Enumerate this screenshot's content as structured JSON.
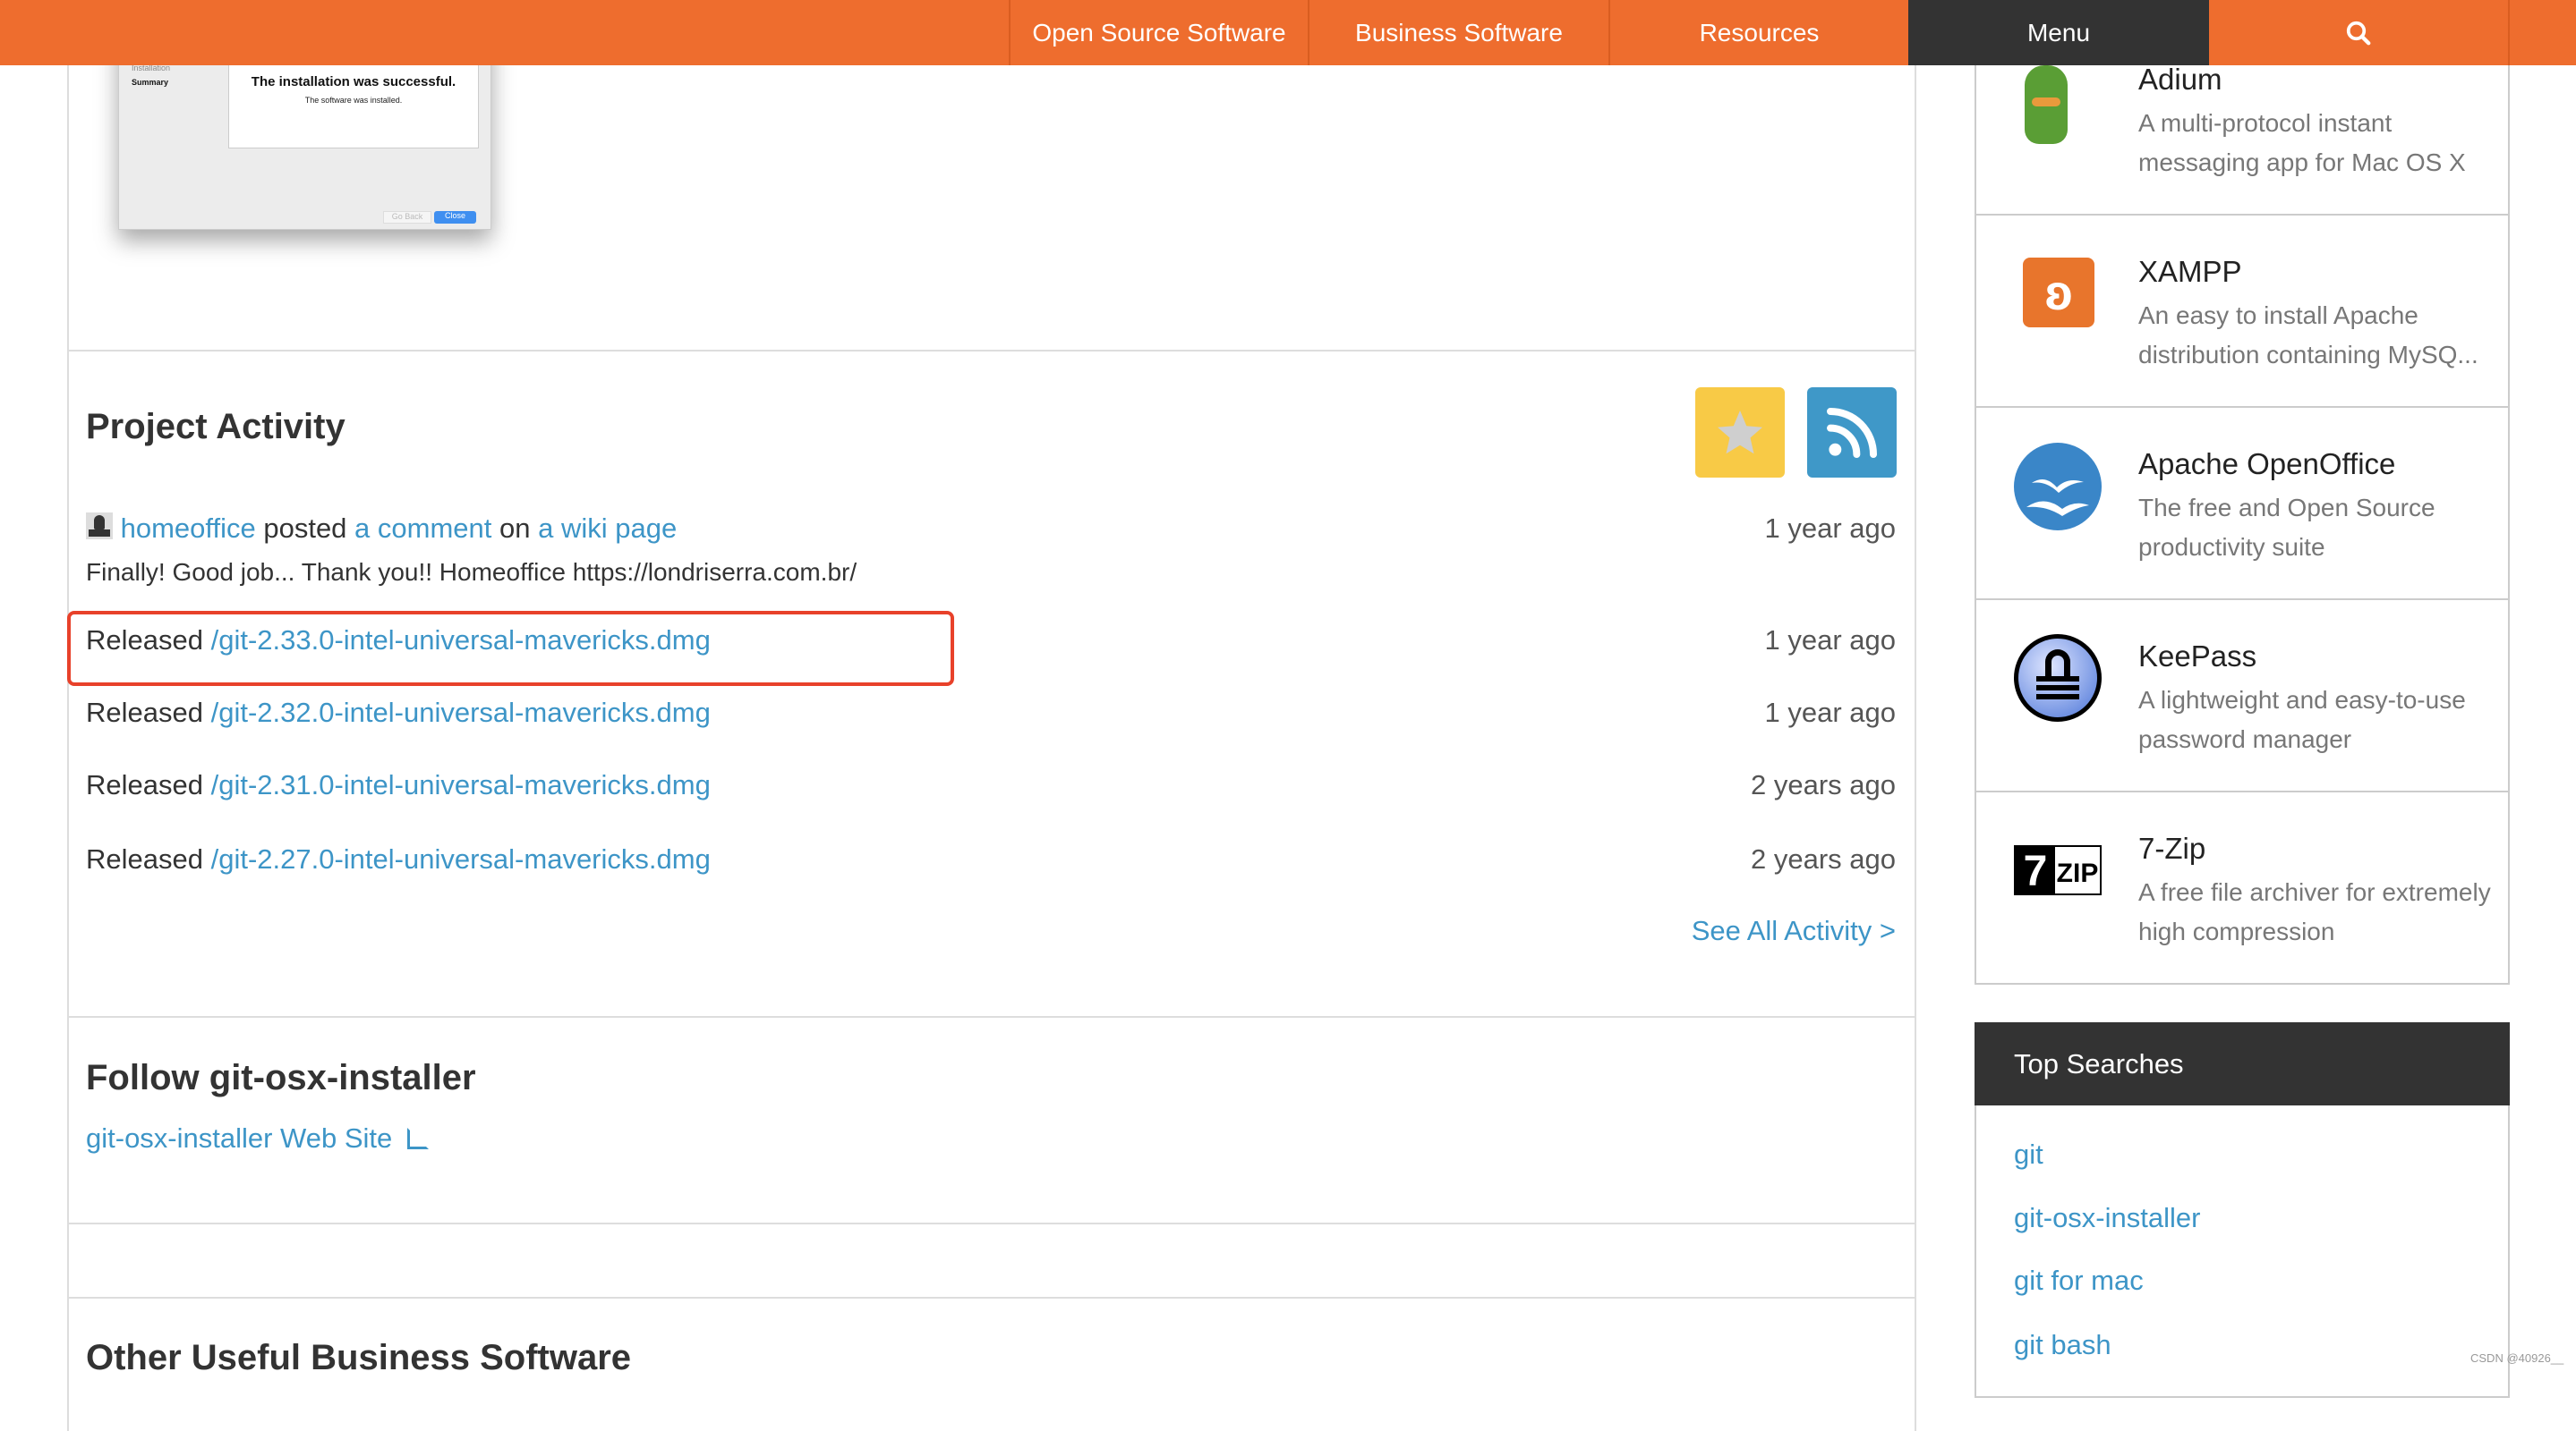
{
  "nav": {
    "items": [
      "Open Source Software",
      "Business Software",
      "Resources",
      "Menu"
    ],
    "search_icon": "search-icon",
    "color": "#ee6d2e",
    "menu_color": "#333333"
  },
  "screenshot": {
    "steps": [
      "Installation",
      "Summary"
    ],
    "heading": "The installation was successful.",
    "sub": "The software was installed.",
    "go_back": "Go Back",
    "close": "Close"
  },
  "activity": {
    "title": "Project Activity",
    "comment": {
      "user": "homeoffice",
      "posted": "posted",
      "comment_link": "a comment",
      "on": "on",
      "page_link": "a wiki page",
      "time": "1 year ago",
      "text": "Finally! Good job... Thank you!! Homeoffice https://londriserra.com.br/"
    },
    "releases": [
      {
        "label": "Released",
        "file": "/git-2.33.0-intel-universal-mavericks.dmg",
        "time": "1 year ago",
        "highlighted": true
      },
      {
        "label": "Released",
        "file": "/git-2.32.0-intel-universal-mavericks.dmg",
        "time": "1 year ago"
      },
      {
        "label": "Released",
        "file": "/git-2.31.0-intel-universal-mavericks.dmg",
        "time": "2 years ago"
      },
      {
        "label": "Released",
        "file": "/git-2.27.0-intel-universal-mavericks.dmg",
        "time": "2 years ago"
      }
    ],
    "see_all": "See All Activity >"
  },
  "follow": {
    "title": "Follow git-osx-installer",
    "link": "git-osx-installer Web Site"
  },
  "other": {
    "title": "Other Useful Business Software"
  },
  "sidebar": {
    "items": [
      {
        "name": "Adium",
        "desc": "A multi-protocol instant messaging app for Mac OS X"
      },
      {
        "name": "XAMPP",
        "desc": "An easy to install Apache distribution containing MySQ..."
      },
      {
        "name": "Apache OpenOffice",
        "desc": "The free and Open Source productivity suite"
      },
      {
        "name": "KeePass",
        "desc": "A lightweight and easy-to-use password manager"
      },
      {
        "name": "7-Zip",
        "desc": "A free file archiver for extremely high compression"
      }
    ]
  },
  "top_searches": {
    "title": "Top Searches",
    "items": [
      "git",
      "git-osx-installer",
      "git for mac",
      "git bash"
    ]
  },
  "watermark": "CSDN @40926__"
}
